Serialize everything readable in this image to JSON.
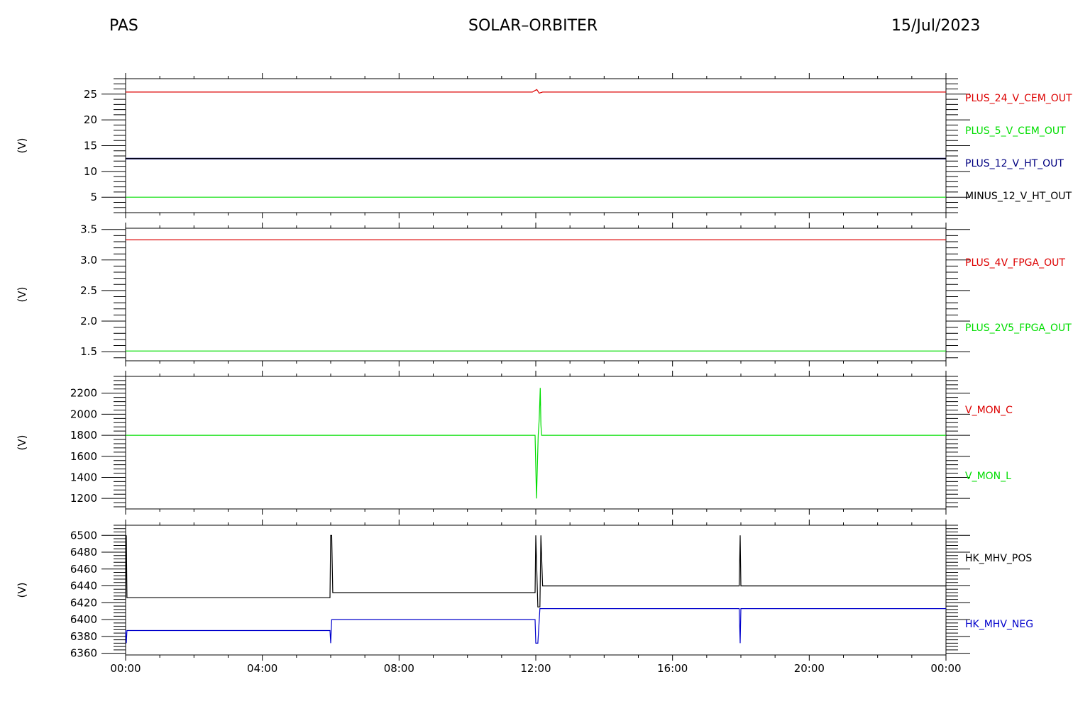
{
  "header": {
    "instrument": "PAS",
    "mission": "SOLAR–ORBITER",
    "date": "15/Jul/2023"
  },
  "chart_data": [
    {
      "type": "line",
      "ylabel": "(V)",
      "ylim": [
        2,
        28
      ],
      "yticks": [
        5,
        10,
        15,
        20,
        25
      ],
      "x_ticks": [
        "00:00",
        "04:00",
        "08:00",
        "12:00",
        "16:00",
        "20:00",
        "00:00"
      ],
      "x_range_hours": [
        0,
        24
      ],
      "legend_position": "right",
      "series": [
        {
          "name": "PLUS_24_V_CEM_OUT",
          "color": "#dd0000",
          "x": [
            0,
            11.9,
            12.03,
            12.1,
            12.2,
            24
          ],
          "values": [
            25.4,
            25.4,
            25.9,
            25.2,
            25.4,
            25.4
          ]
        },
        {
          "name": "PLUS_5_V_CEM_OUT",
          "color": "#00dd00",
          "x": [
            0,
            24
          ],
          "values": [
            5.0,
            5.0
          ]
        },
        {
          "name": "PLUS_12_V_HT_OUT",
          "color": "#000080",
          "x": [
            0,
            24
          ],
          "values": [
            12.5,
            12.5
          ]
        },
        {
          "name": "MINUS_12_V_HT_OUT",
          "color": "#000000",
          "x": [
            0,
            24
          ],
          "values": [
            12.5,
            12.5
          ]
        }
      ]
    },
    {
      "type": "line",
      "ylabel": "(V)",
      "ylim": [
        1.35,
        3.52
      ],
      "yticks": [
        1.5,
        2.0,
        2.5,
        3.0,
        3.5
      ],
      "ytick_labels": [
        "1.5",
        "2.0",
        "2.5",
        "3.0",
        "3.5"
      ],
      "x_ticks": [
        "00:00",
        "04:00",
        "08:00",
        "12:00",
        "16:00",
        "20:00",
        "00:00"
      ],
      "x_range_hours": [
        0,
        24
      ],
      "legend_position": "right",
      "series": [
        {
          "name": "PLUS_4V_FPGA_OUT",
          "color": "#dd0000",
          "x": [
            0,
            24
          ],
          "values": [
            3.33,
            3.33
          ]
        },
        {
          "name": "PLUS_2V5_FPGA_OUT",
          "color": "#00dd00",
          "x": [
            0,
            24
          ],
          "values": [
            1.51,
            1.51
          ]
        }
      ]
    },
    {
      "type": "line",
      "ylabel": "(V)",
      "ylim": [
        1100,
        2360
      ],
      "yticks": [
        1200,
        1400,
        1600,
        1800,
        2000,
        2200
      ],
      "x_ticks": [
        "00:00",
        "04:00",
        "08:00",
        "12:00",
        "16:00",
        "20:00",
        "00:00"
      ],
      "x_range_hours": [
        0,
        24
      ],
      "legend_position": "right",
      "series": [
        {
          "name": "V_MON_C",
          "color": "#dd0000",
          "x": [],
          "values": []
        },
        {
          "name": "V_MON_L",
          "color": "#00dd00",
          "x": [
            0,
            11.98,
            12.02,
            12.07,
            12.1,
            12.13,
            12.15,
            12.17,
            12.2,
            24
          ],
          "values": [
            1800,
            1800,
            1200,
            1800,
            1950,
            2250,
            1900,
            1800,
            1800,
            1800
          ]
        }
      ]
    },
    {
      "type": "line",
      "ylabel": "(V)",
      "ylim": [
        6358,
        6512
      ],
      "yticks": [
        6360,
        6380,
        6400,
        6420,
        6440,
        6460,
        6480,
        6500
      ],
      "x_ticks": [
        "00:00",
        "04:00",
        "08:00",
        "12:00",
        "16:00",
        "20:00",
        "00:00"
      ],
      "x_range_hours": [
        0,
        24
      ],
      "legend_position": "right",
      "series": [
        {
          "name": "HK_MHV_POS",
          "color": "#000000",
          "x": [
            0,
            0.02,
            0.04,
            0.06,
            5.98,
            6.0,
            6.03,
            6.06,
            11.98,
            12.0,
            12.06,
            12.12,
            12.15,
            12.2,
            17.95,
            17.98,
            18.0,
            24
          ],
          "values": [
            6426,
            6500,
            6426,
            6426,
            6426,
            6500,
            6500,
            6432,
            6432,
            6500,
            6415,
            6415,
            6500,
            6440,
            6440,
            6500,
            6440,
            6440
          ]
        },
        {
          "name": "HK_MHV_NEG",
          "color": "#0000cc",
          "x": [
            0,
            0.02,
            0.04,
            0.06,
            5.98,
            6.0,
            6.03,
            6.06,
            11.98,
            12.0,
            12.06,
            12.12,
            12.15,
            12.2,
            17.95,
            17.98,
            18.0,
            24
          ],
          "values": [
            6387,
            6372,
            6387,
            6387,
            6387,
            6372,
            6400,
            6400,
            6400,
            6372,
            6372,
            6413,
            6413,
            6413,
            6413,
            6372,
            6413,
            6413
          ]
        }
      ]
    }
  ]
}
